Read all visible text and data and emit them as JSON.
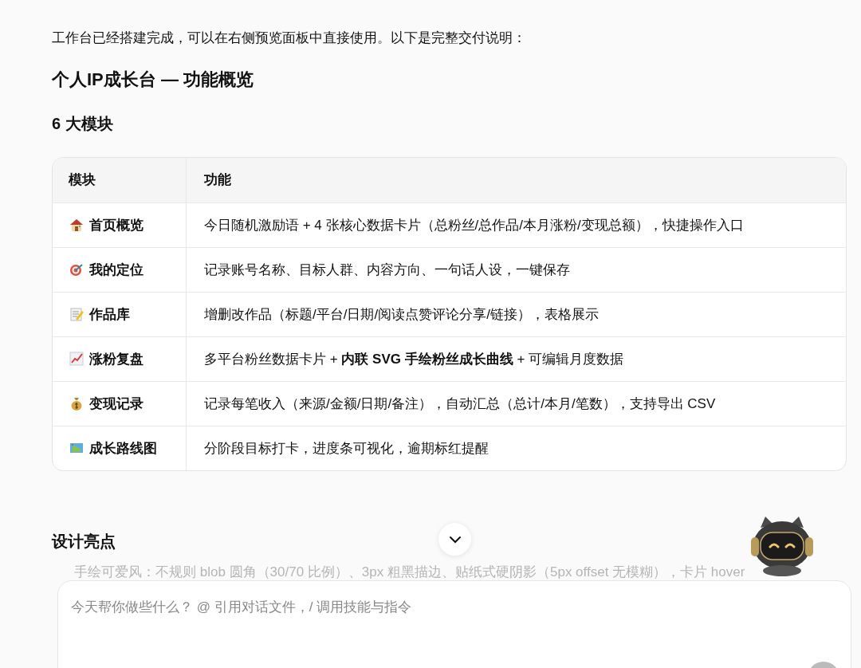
{
  "intro": "工作台已经搭建完成，可以在右侧预览面板中直接使用。以下是完整交付说明：",
  "title": "个人IP成长台 — 功能概览",
  "section_heading": "6 大模块",
  "table": {
    "columns": [
      "模块",
      "功能"
    ],
    "rows": [
      {
        "kind": "house",
        "module": "首页概览",
        "function": "今日随机激励语 + 4 张核心数据卡片（总粉丝/总作品/本月涨粉/变现总额），快捷操作入口"
      },
      {
        "kind": "target",
        "module": "我的定位",
        "function": "记录账号名称、目标人群、内容方向、一句话人设，一键保存"
      },
      {
        "kind": "memo",
        "module": "作品库",
        "function": "增删改作品（标题/平台/日期/阅读点赞评论分享/链接），表格展示"
      },
      {
        "kind": "chart",
        "module": "涨粉复盘",
        "function": "多平台粉丝数据卡片 + **内联 SVG 手绘粉丝成长曲线** + 可编辑月度数据"
      },
      {
        "kind": "moneybag",
        "module": "变现记录",
        "function": "记录每笔收入（来源/金额/日期/备注），自动汇总（总计/本月/笔数），支持导出 CSV"
      },
      {
        "kind": "map",
        "module": "成长路线图",
        "function": "分阶段目标打卡，进度条可视化，逾期标红提醒"
      }
    ]
  },
  "design_heading": "设计亮点",
  "design_bullet": "手绘可爱风：不规则 blob 圆角（30/70 比例）、3px 粗黑描边、贴纸式硬阴影（5px offset 无模糊），卡片 hover",
  "composer": {
    "placeholder": "今天帮你做些什么？ @ 引用对话文件，/ 调用技能与指令"
  }
}
